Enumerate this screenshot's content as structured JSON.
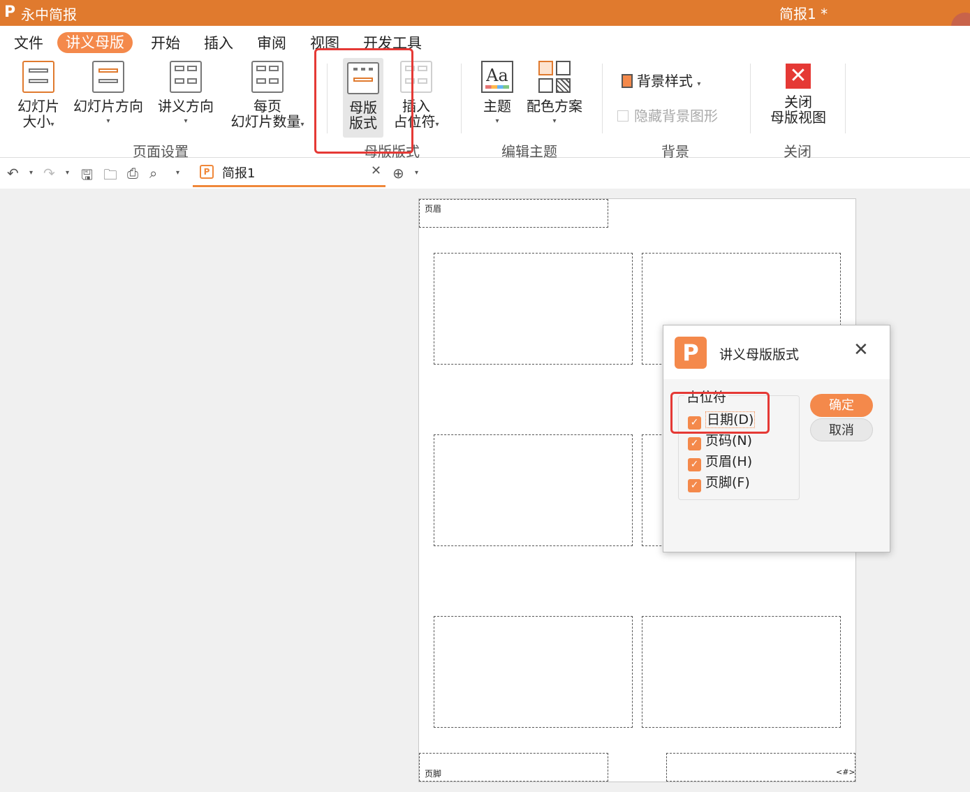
{
  "titlebar": {
    "logo": "P",
    "app_name": "永中简报",
    "doc_title": "简报1 *"
  },
  "menu": {
    "items": [
      "文件",
      "讲义母版",
      "开始",
      "插入",
      "审阅",
      "视图",
      "开发工具"
    ],
    "active": "讲义母版"
  },
  "ribbon": {
    "slide_size": [
      "幻灯片",
      "大小"
    ],
    "slide_orientation": "幻灯片方向",
    "handout_orientation": "讲义方向",
    "slides_per_page": [
      "每页",
      "幻灯片数量"
    ],
    "master_layout": [
      "母版",
      "版式"
    ],
    "insert_placeholder": [
      "插入",
      "占位符"
    ],
    "theme": "主题",
    "color_scheme": "配色方案",
    "background_style": "背景样式",
    "hide_bg_graphics": "隐藏背景图形",
    "close_master": [
      "关闭",
      "母版视图"
    ],
    "groups": {
      "page_setup": "页面设置",
      "master_layout": "母版版式",
      "edit_theme": "编辑主题",
      "background": "背景",
      "close": "关闭"
    }
  },
  "doc_tab": {
    "name": "简报1"
  },
  "page": {
    "header_label": "页眉",
    "footer_label": "页脚",
    "page_number": "<#>"
  },
  "dialog": {
    "logo": "P",
    "title": "讲义母版版式",
    "legend": "占位符",
    "options": [
      {
        "label": "日期(D)",
        "checked": true
      },
      {
        "label": "页码(N)",
        "checked": true
      },
      {
        "label": "页眉(H)",
        "checked": true
      },
      {
        "label": "页脚(F)",
        "checked": true
      }
    ],
    "ok": "确定",
    "cancel": "取消"
  },
  "colors": {
    "accent": "#e07a2e",
    "button": "#f4894b",
    "highlight": "#e53935"
  }
}
